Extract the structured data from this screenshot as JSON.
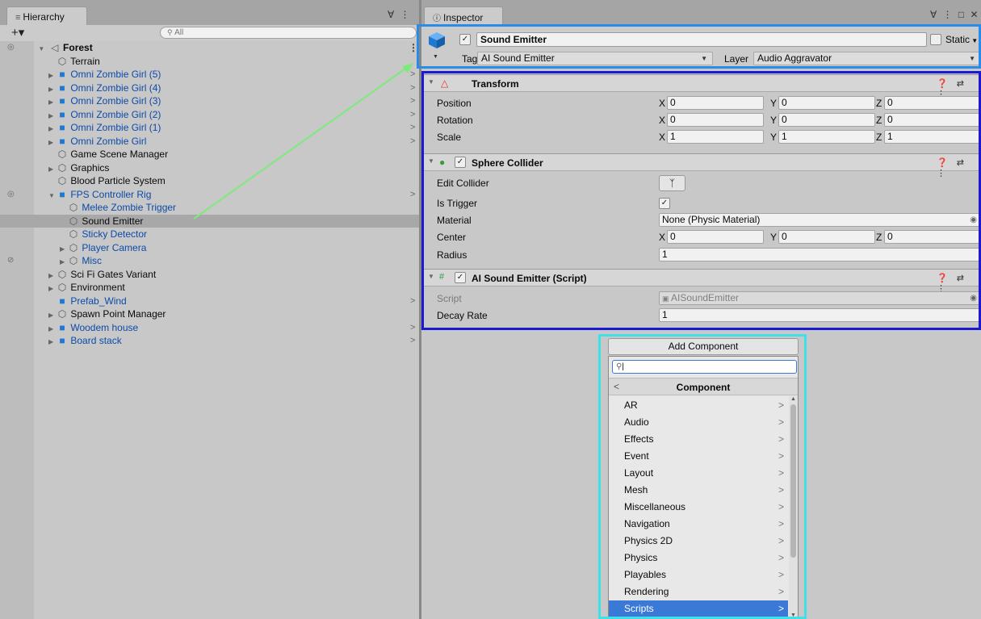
{
  "hierarchy": {
    "tab_title": "Hierarchy",
    "tab_tools": "∀ ⋮",
    "add_button": "+▾",
    "search_placeholder": "All",
    "scene": "Forest",
    "items": [
      {
        "label": "Terrain",
        "kind": "go",
        "depth": 1,
        "arrow": "",
        "blue": false
      },
      {
        "label": "Omni Zombie Girl (5)",
        "kind": "prefab",
        "depth": 1,
        "arrow": "right",
        "blue": true,
        "chevron": true
      },
      {
        "label": "Omni Zombie Girl (4)",
        "kind": "prefab",
        "depth": 1,
        "arrow": "right",
        "blue": true,
        "chevron": true
      },
      {
        "label": "Omni Zombie Girl (3)",
        "kind": "prefab",
        "depth": 1,
        "arrow": "right",
        "blue": true,
        "chevron": true
      },
      {
        "label": "Omni Zombie Girl (2)",
        "kind": "prefab",
        "depth": 1,
        "arrow": "right",
        "blue": true,
        "chevron": true
      },
      {
        "label": "Omni Zombie Girl (1)",
        "kind": "prefab",
        "depth": 1,
        "arrow": "right",
        "blue": true,
        "chevron": true
      },
      {
        "label": "Omni Zombie Girl",
        "kind": "prefab",
        "depth": 1,
        "arrow": "right",
        "blue": true,
        "chevron": true
      },
      {
        "label": "Game Scene Manager",
        "kind": "go",
        "depth": 1,
        "arrow": "",
        "blue": false
      },
      {
        "label": "Graphics",
        "kind": "go",
        "depth": 1,
        "arrow": "right",
        "blue": false
      },
      {
        "label": "Blood Particle System",
        "kind": "go",
        "depth": 1,
        "arrow": "",
        "blue": false
      },
      {
        "label": "FPS Controller Rig",
        "kind": "prefab",
        "depth": 1,
        "arrow": "down",
        "blue": true,
        "chevron": true,
        "eye": true
      },
      {
        "label": "Melee Zombie Trigger",
        "kind": "go",
        "depth": 2,
        "arrow": "",
        "blue": true
      },
      {
        "label": "Sound Emitter",
        "kind": "go",
        "depth": 2,
        "arrow": "",
        "blue": false,
        "selected": true
      },
      {
        "label": "Sticky Detector",
        "kind": "go",
        "depth": 2,
        "arrow": "",
        "blue": true
      },
      {
        "label": "Player Camera",
        "kind": "go",
        "depth": 2,
        "arrow": "right",
        "blue": true
      },
      {
        "label": "Misc",
        "kind": "go",
        "depth": 2,
        "arrow": "right",
        "blue": true,
        "hidden": true
      },
      {
        "label": "Sci Fi Gates Variant",
        "kind": "go",
        "depth": 1,
        "arrow": "right",
        "blue": false
      },
      {
        "label": "Environment",
        "kind": "go",
        "depth": 1,
        "arrow": "right",
        "blue": false
      },
      {
        "label": "Prefab_Wind",
        "kind": "prefab",
        "depth": 1,
        "arrow": "",
        "blue": true,
        "chevron": true
      },
      {
        "label": "Spawn Point Manager",
        "kind": "go",
        "depth": 1,
        "arrow": "right",
        "blue": false
      },
      {
        "label": "Woodem house",
        "kind": "prefab",
        "depth": 1,
        "arrow": "right",
        "blue": true,
        "chevron": true
      },
      {
        "label": "Board stack",
        "kind": "prefab",
        "depth": 1,
        "arrow": "right",
        "blue": true,
        "chevron": true
      }
    ]
  },
  "inspector": {
    "tab_title": "Inspector",
    "tab_tools": "∀ ⋮ □ ✕",
    "object_name": "Sound Emitter",
    "static_label": "Static",
    "tag_label": "Tag",
    "tag_value": "AI Sound Emitter",
    "layer_label": "Layer",
    "layer_value": "Audio Aggravator",
    "transform": {
      "title": "Transform",
      "tools": "❓ ⇄ ⋮",
      "rows": [
        {
          "label": "Position",
          "x": "0",
          "y": "0",
          "z": "0"
        },
        {
          "label": "Rotation",
          "x": "0",
          "y": "0",
          "z": "0"
        },
        {
          "label": "Scale",
          "x": "1",
          "y": "1",
          "z": "1"
        }
      ]
    },
    "sphere_collider": {
      "title": "Sphere Collider",
      "tools": "❓ ⇄ ⋮",
      "edit_collider_label": "Edit Collider",
      "is_trigger_label": "Is Trigger",
      "is_trigger_value": "✓",
      "material_label": "Material",
      "material_value": "None (Physic Material)",
      "center_label": "Center",
      "center": {
        "x": "0",
        "y": "0",
        "z": "0"
      },
      "radius_label": "Radius",
      "radius_value": "1"
    },
    "script_component": {
      "title": "AI Sound Emitter (Script)",
      "tools": "❓ ⇄ ⋮",
      "script_label": "Script",
      "script_value": "AISoundEmitter",
      "decay_label": "Decay Rate",
      "decay_value": "1"
    },
    "add_component_label": "Add Component"
  },
  "add_component_popup": {
    "search_value": "",
    "category_title": "Component",
    "items": [
      "AR",
      "Audio",
      "Effects",
      "Event",
      "Layout",
      "Mesh",
      "Miscellaneous",
      "Navigation",
      "Physics 2D",
      "Physics",
      "Playables",
      "Rendering",
      "Scripts"
    ],
    "selected": "Scripts"
  },
  "annotations": {
    "arrow_color": "#7dea7d",
    "header_box_color": "#2b8ce8",
    "components_box_color": "#1a1ad0",
    "popup_box_color": "#3fe0e8"
  }
}
